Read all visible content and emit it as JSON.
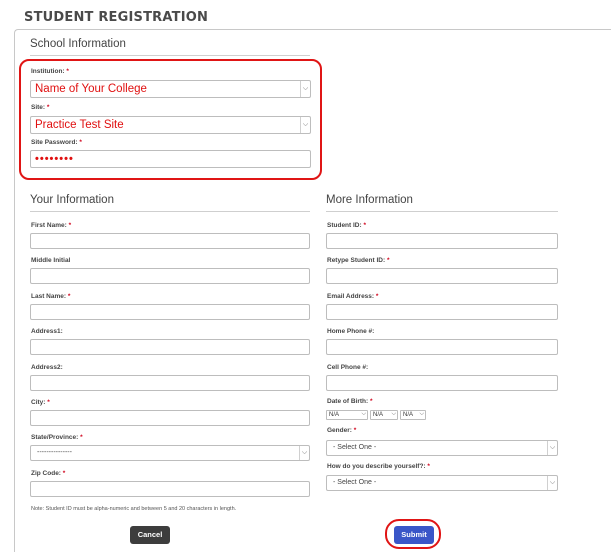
{
  "page_title": "STUDENT REGISTRATION",
  "school": {
    "title": "School Information",
    "institution_label": "Institution:",
    "institution_value": "Name of Your College",
    "site_label": "Site:",
    "site_value": "Practice Test Site",
    "password_label": "Site Password:",
    "password_value": "••••••••"
  },
  "required_mark": "*",
  "your_info": {
    "title": "Your Information",
    "first_name_label": "First Name:",
    "middle_initial_label": "Middle Initial",
    "last_name_label": "Last Name:",
    "address1_label": "Address1:",
    "address2_label": "Address2:",
    "city_label": "City:",
    "state_label": "State/Province:",
    "state_value": "---------------",
    "zip_label": "Zip Code:"
  },
  "more_info": {
    "title": "More Information",
    "student_id_label": "Student ID:",
    "retype_id_label": "Retype Student ID:",
    "email_label": "Email Address:",
    "home_phone_label": "Home Phone #:",
    "cell_phone_label": "Cell Phone #:",
    "dob_label": "Date of Birth:",
    "dob_month": "N/A",
    "dob_day": "N/A",
    "dob_year": "N/A",
    "gender_label": "Gender:",
    "gender_value": "- Select One -",
    "describe_label": "How do you describe yourself?:",
    "describe_value": "- Select One -"
  },
  "note": "Note: Student ID must be alpha-numeric and between 5 and 20 characters in length.",
  "buttons": {
    "cancel": "Cancel",
    "submit": "Submit"
  },
  "icons": {
    "dropdown": "chevron-down-icon"
  },
  "colors": {
    "highlight": "#e01515",
    "submit": "#3a56c8",
    "cancel": "#3d3d3d",
    "required": "#d0021b"
  }
}
